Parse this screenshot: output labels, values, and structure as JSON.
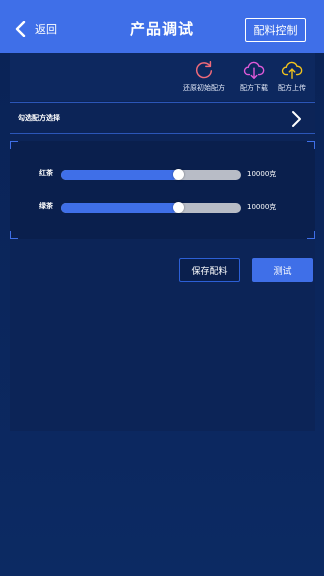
{
  "header": {
    "back_label": "返回",
    "title": "产品调试",
    "right_button": "配料控制",
    "color": "#3f6fe8"
  },
  "toolbar": {
    "items": [
      {
        "label": "还原初始配方",
        "icon": "reset-icon",
        "color": "#f06a7a"
      },
      {
        "label": "配方下载",
        "icon": "cloud-download-icon",
        "color": "#e05ad8"
      },
      {
        "label": "配方上传",
        "icon": "cloud-upload-icon",
        "color": "#f2c31c"
      }
    ]
  },
  "recipe_select": {
    "label": "勾选配方选择",
    "icon": "chevron-right-icon"
  },
  "sliders": [
    {
      "name": "红茶",
      "value_text": "10000克",
      "level": 0.65
    },
    {
      "name": "绿茶",
      "value_text": "10000克",
      "level": 0.65
    }
  ],
  "actions": {
    "save_label": "保存配料",
    "test_label": "测试"
  }
}
